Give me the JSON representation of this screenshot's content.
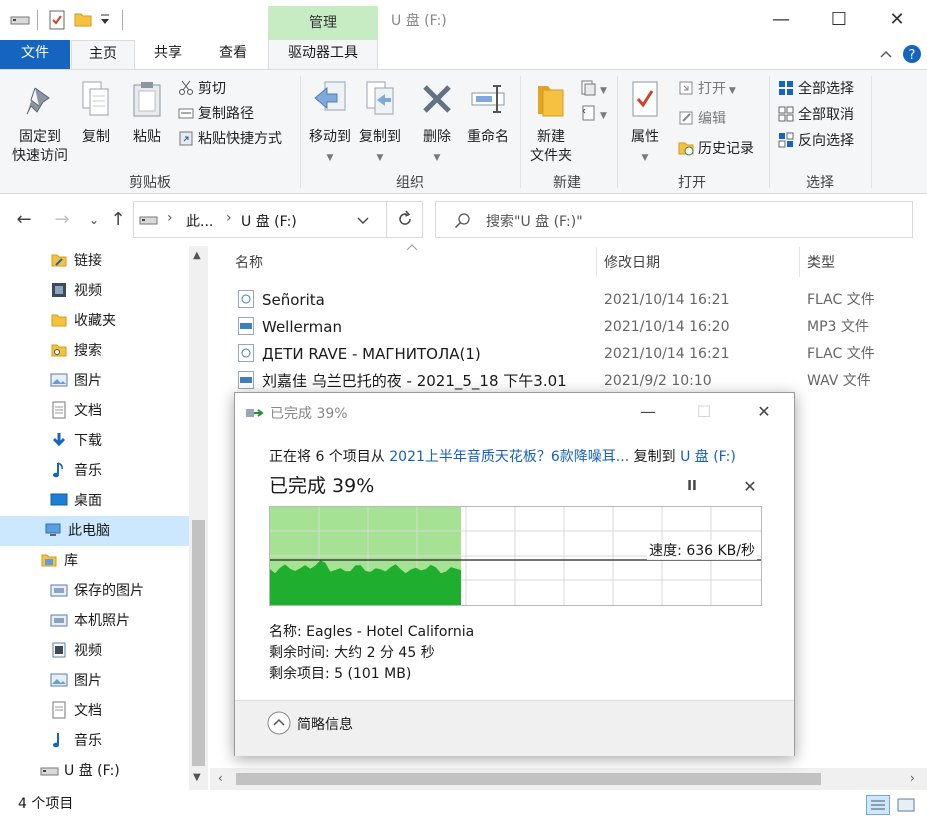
{
  "titlebar": {
    "manage_tab": "管理",
    "title": "U 盘 (F:)",
    "minimize": "—",
    "maximize": "☐",
    "close": "✕"
  },
  "ribbon_tabs": {
    "file": "文件",
    "home": "主页",
    "share": "共享",
    "view": "查看",
    "drive_tools": "驱动器工具"
  },
  "ribbon": {
    "pin_line1": "固定到",
    "pin_line2": "快速访问",
    "copy": "复制",
    "paste": "粘贴",
    "cut": "剪切",
    "copy_path": "复制路径",
    "paste_shortcut": "粘贴快捷方式",
    "group_clipboard": "剪贴板",
    "move_to": "移动到",
    "copy_to": "复制到",
    "delete": "删除",
    "rename": "重命名",
    "group_organize": "组织",
    "new_folder_line1": "新建",
    "new_folder_line2": "文件夹",
    "group_new": "新建",
    "properties": "属性",
    "open": "打开",
    "edit": "编辑",
    "history": "历史记录",
    "group_open": "打开",
    "select_all": "全部选择",
    "select_none": "全部取消",
    "invert_selection": "反向选择",
    "group_select": "选择"
  },
  "address": {
    "crumb_pc": "此...",
    "crumb_drive": "U 盘 (F:)",
    "search_placeholder": "搜索\"U 盘 (F:)\""
  },
  "leftnav": {
    "items": [
      {
        "label": "链接",
        "icon": "folder-link-icon"
      },
      {
        "label": "视频",
        "icon": "video-icon"
      },
      {
        "label": "收藏夹",
        "icon": "star-folder-icon"
      },
      {
        "label": "搜索",
        "icon": "search-folder-icon"
      },
      {
        "label": "图片",
        "icon": "pictures-icon"
      },
      {
        "label": "文档",
        "icon": "documents-icon"
      },
      {
        "label": "下载",
        "icon": "download-icon"
      },
      {
        "label": "音乐",
        "icon": "music-icon"
      },
      {
        "label": "桌面",
        "icon": "desktop-icon"
      },
      {
        "label": "此电脑",
        "icon": "this-pc-icon"
      },
      {
        "label": "库",
        "icon": "library-icon"
      },
      {
        "label": "保存的图片",
        "icon": "saved-pictures-icon"
      },
      {
        "label": "本机照片",
        "icon": "camera-roll-icon"
      },
      {
        "label": "视频",
        "icon": "video-icon"
      },
      {
        "label": "图片",
        "icon": "pictures-icon"
      },
      {
        "label": "文档",
        "icon": "documents-icon"
      },
      {
        "label": "音乐",
        "icon": "music-icon"
      },
      {
        "label": "U 盘 (F:)",
        "icon": "usb-drive-icon"
      }
    ]
  },
  "filelist": {
    "col_name": "名称",
    "col_date": "修改日期",
    "col_type": "类型",
    "rows": [
      {
        "name": "Señorita",
        "date": "2021/10/14 16:21",
        "type": "FLAC 文件",
        "icon": "flac-file-icon"
      },
      {
        "name": "Wellerman",
        "date": "2021/10/14 16:20",
        "type": "MP3 文件",
        "icon": "mp3-file-icon"
      },
      {
        "name": "ДЕТИ RAVE - МАГНИТОЛА(1)",
        "date": "2021/10/14 16:21",
        "type": "FLAC 文件",
        "icon": "flac-file-icon"
      },
      {
        "name": "刘嘉佳 乌兰巴托的夜 - 2021_5_18 下午3.01",
        "date": "2021/9/2 10:10",
        "type": "WAV 文件",
        "icon": "wav-file-icon"
      }
    ]
  },
  "status": {
    "item_count": "4 个项目"
  },
  "dialog": {
    "title": "已完成 39%",
    "line_prefix": "正在将 6 个项目从 ",
    "source": "2021上半年音质天花板？6款降噪耳...",
    "line_mid": " 复制到 ",
    "dest": "U 盘 (F:)",
    "percent_text": "已完成 39%",
    "speed": "速度: 636 KB/秒",
    "name": "名称: Eagles - Hotel California",
    "time_left": "剩余时间: 大约 2 分 45 秒",
    "items_left": "剩余项目: 5 (101 MB)",
    "less_details": "简略信息",
    "progress_fraction": 0.39,
    "pause": "II",
    "cancel": "✕"
  },
  "colors": {
    "accent": "#1565c0",
    "manage_tab": "#c7ecc4",
    "progress_light": "#a6e294",
    "progress_dark": "#1fae2d",
    "link": "#1560bd"
  }
}
